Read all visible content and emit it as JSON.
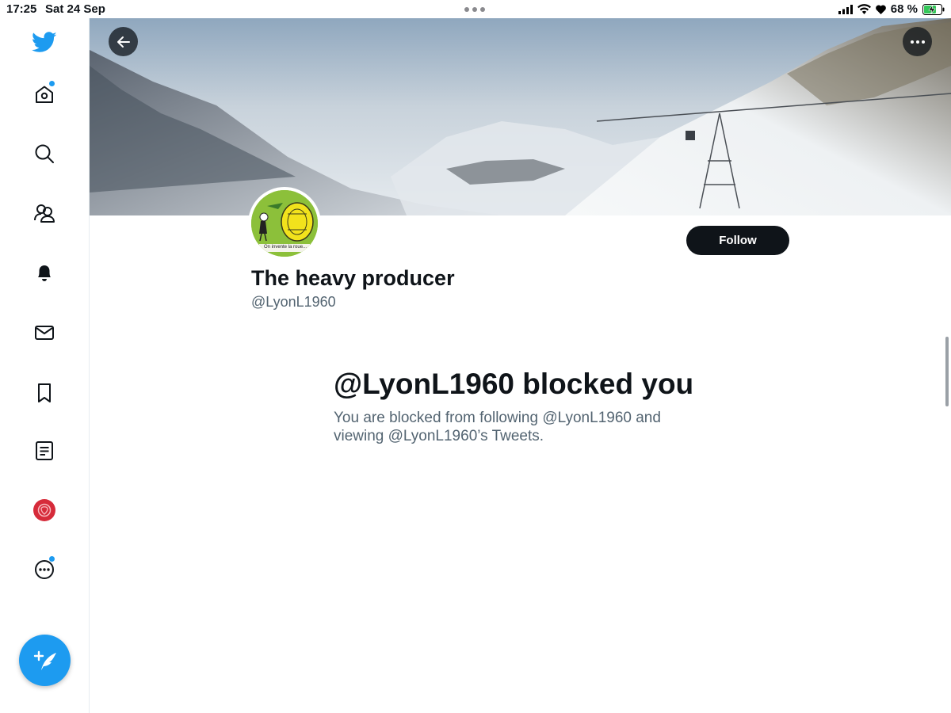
{
  "status_bar": {
    "time": "17:25",
    "date": "Sat 24 Sep",
    "battery_percent": "68 %",
    "icons": [
      "signal-icon",
      "wifi-icon",
      "heart-icon",
      "battery-charging-icon"
    ]
  },
  "sidebar": {
    "logo": "twitter-bird-icon",
    "items": [
      {
        "name": "home",
        "icon": "home-icon",
        "has_badge": true
      },
      {
        "name": "explore",
        "icon": "search-icon",
        "has_badge": false
      },
      {
        "name": "communities",
        "icon": "communities-icon",
        "has_badge": false
      },
      {
        "name": "notifications",
        "icon": "bell-icon",
        "has_badge": false
      },
      {
        "name": "messages",
        "icon": "envelope-icon",
        "has_badge": false
      },
      {
        "name": "bookmarks",
        "icon": "bookmark-icon",
        "has_badge": false
      },
      {
        "name": "lists",
        "icon": "list-icon",
        "has_badge": false
      },
      {
        "name": "profile",
        "icon": "avatar-icon",
        "has_badge": false
      },
      {
        "name": "more",
        "icon": "more-circle-icon",
        "has_badge": true
      }
    ],
    "compose_icon": "compose-tweet-icon"
  },
  "colors": {
    "accent": "#1d9bf0",
    "text_primary": "#0f1419",
    "text_secondary": "#536471",
    "follow_bg": "#0f1419"
  },
  "header": {
    "back_icon": "arrow-left-icon",
    "more_icon": "ellipsis-icon"
  },
  "profile": {
    "avatar_caption": "On invente la roue...",
    "display_name": "The heavy producer",
    "handle": "@LyonL1960",
    "follow_label": "Follow"
  },
  "blocked": {
    "title": "@LyonL1960 blocked you",
    "description": "You are blocked from following @LyonL1960 and viewing @LyonL1960’s Tweets."
  }
}
